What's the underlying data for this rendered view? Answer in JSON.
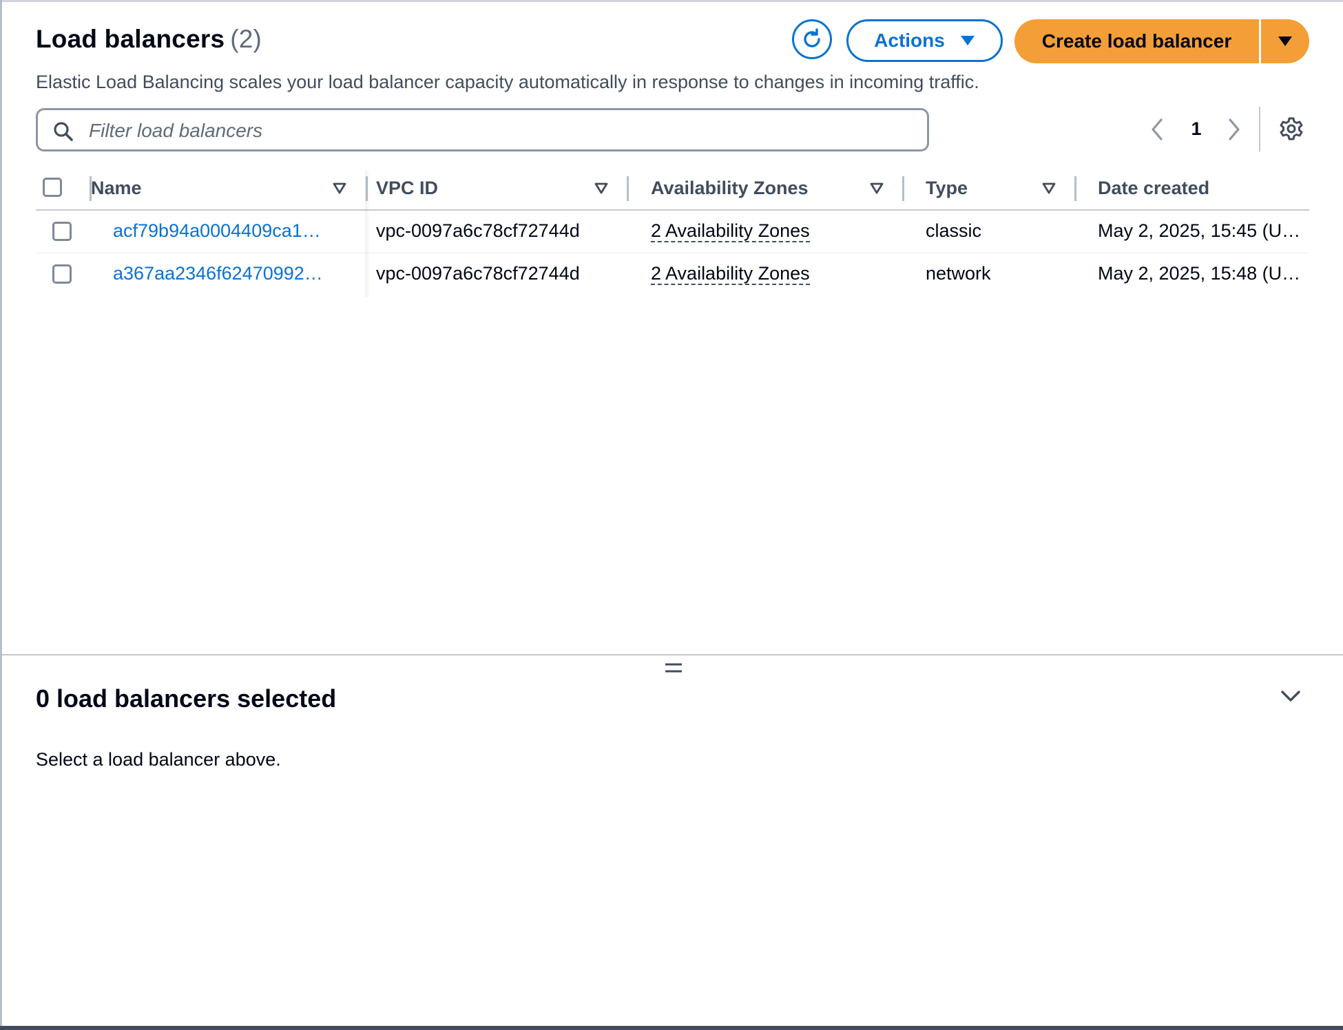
{
  "header": {
    "title": "Load balancers",
    "count": "(2)",
    "description": "Elastic Load Balancing scales your load balancer capacity automatically in response to changes in incoming traffic."
  },
  "toolbar": {
    "refresh_icon": "refresh-icon",
    "actions_label": "Actions",
    "create_label": "Create load balancer"
  },
  "search": {
    "placeholder": "Filter load balancers",
    "value": ""
  },
  "pagination": {
    "current_page": "1"
  },
  "table": {
    "columns": [
      "Name",
      "VPC ID",
      "Availability Zones",
      "Type",
      "Date created"
    ],
    "rows": [
      {
        "name": "acf79b94a0004409ca1…",
        "vpc_id": "vpc-0097a6c78cf72744d",
        "availability_zones": "2 Availability Zones",
        "type": "classic",
        "date_created": "May 2, 2025, 15:45 (UT…"
      },
      {
        "name": "a367aa2346f62470992…",
        "vpc_id": "vpc-0097a6c78cf72744d",
        "availability_zones": "2 Availability Zones",
        "type": "network",
        "date_created": "May 2, 2025, 15:48 (UT…"
      }
    ]
  },
  "details_panel": {
    "title": "0 load balancers selected",
    "message": "Select a load balancer above."
  },
  "colors": {
    "primary_blue": "#0972d3",
    "create_button_orange": "#f49e37",
    "text_dark": "#000716",
    "text_muted": "#414d5c"
  }
}
